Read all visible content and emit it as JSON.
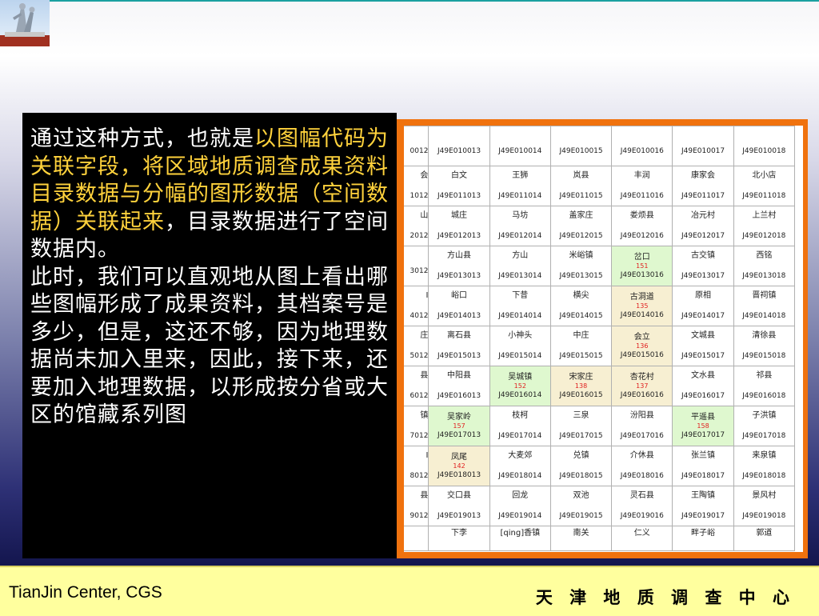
{
  "slide": {
    "paragraph1": {
      "part1": "通过这种方式，也就是",
      "highlight": "以图幅代码为关联字段，将区域地质调查成果资料目录数据与分幅的图形数据（空间数据）关联起来",
      "part2": "，目录数据进行了空间数据内。"
    },
    "paragraph2": "此时，我们可以直观地从图上看出哪些图幅形成了成果资料，其档案号是多少，但是，这还不够，因为地理数据尚未加入里来，因此，接下来，还要加入地理数据，以形成按分省或大区的馆藏系列图",
    "highlight_color": "#ffd23c"
  },
  "footer": {
    "left": "TianJin Center, CGS",
    "right": "天 津 地 质 调 查 中 心"
  },
  "colors": {
    "frame_orange": "#f0720e",
    "footer_yellow": "#ffff9e",
    "cell_green": "#dff8cf",
    "cell_beige": "#f7efd2",
    "number_red": "#e02020"
  },
  "map_table": {
    "rows": [
      {
        "cells": [
          {
            "name": "",
            "code": "0012"
          },
          {
            "name": "",
            "code": "J49E010013"
          },
          {
            "name": "",
            "code": "J49E010014"
          },
          {
            "name": "",
            "code": "J49E010015"
          },
          {
            "name": "",
            "code": "J49E010016"
          },
          {
            "name": "",
            "code": "J49E010017"
          },
          {
            "name": "",
            "code": "J49E010018"
          }
        ]
      },
      {
        "cells": [
          {
            "name": "会",
            "code": "1012"
          },
          {
            "name": "白文",
            "code": "J49E011013"
          },
          {
            "name": "王狮",
            "code": "J49E011014"
          },
          {
            "name": "岚县",
            "code": "J49E011015"
          },
          {
            "name": "丰润",
            "code": "J49E011016"
          },
          {
            "name": "康家会",
            "code": "J49E011017"
          },
          {
            "name": "北小店",
            "code": "J49E011018"
          }
        ]
      },
      {
        "cells": [
          {
            "name": "山",
            "code": "2012"
          },
          {
            "name": "城庄",
            "code": "J49E012013"
          },
          {
            "name": "马坊",
            "code": "J49E012014"
          },
          {
            "name": "盖家庄",
            "code": "J49E012015"
          },
          {
            "name": "娄烦县",
            "code": "J49E012016"
          },
          {
            "name": "冶元村",
            "code": "J49E012017"
          },
          {
            "name": "上兰村",
            "code": "J49E012018"
          }
        ]
      },
      {
        "cells": [
          {
            "name": "",
            "code": "3012"
          },
          {
            "name": "方山县",
            "code": "J49E013013"
          },
          {
            "name": "方山",
            "code": "J49E013014"
          },
          {
            "name": "米峪镇",
            "code": "J49E013015"
          },
          {
            "name": "岔口",
            "code": "J49E013016",
            "num": "151",
            "bg": "g"
          },
          {
            "name": "古交镇",
            "code": "J49E013017"
          },
          {
            "name": "西铭",
            "code": "J49E013018"
          }
        ]
      },
      {
        "cells": [
          {
            "name": "Ⅰ",
            "code": "4012"
          },
          {
            "name": "峪口",
            "code": "J49E014013"
          },
          {
            "name": "下昔",
            "code": "J49E014014"
          },
          {
            "name": "横尖",
            "code": "J49E014015"
          },
          {
            "name": "古洞道",
            "code": "J49E014016",
            "num": "135",
            "bg": "b"
          },
          {
            "name": "原相",
            "code": "J49E014017"
          },
          {
            "name": "晋祠镇",
            "code": "J49E014018"
          }
        ]
      },
      {
        "cells": [
          {
            "name": "庄",
            "code": "5012"
          },
          {
            "name": "离石县",
            "code": "J49E015013"
          },
          {
            "name": "小神头",
            "code": "J49E015014"
          },
          {
            "name": "中庄",
            "code": "J49E015015"
          },
          {
            "name": "会立",
            "code": "J49E015016",
            "num": "136",
            "bg": "b"
          },
          {
            "name": "文城县",
            "code": "J49E015017"
          },
          {
            "name": "清徐县",
            "code": "J49E015018"
          }
        ]
      },
      {
        "cells": [
          {
            "name": "县",
            "code": "6012"
          },
          {
            "name": "中阳县",
            "code": "J49E016013"
          },
          {
            "name": "吴城镇",
            "code": "J49E016014",
            "num": "152",
            "bg": "g"
          },
          {
            "name": "宋家庄",
            "code": "J49E016015",
            "num": "138",
            "bg": "b"
          },
          {
            "name": "杏花村",
            "code": "J49E016016",
            "num": "137",
            "bg": "b"
          },
          {
            "name": "文水县",
            "code": "J49E016017"
          },
          {
            "name": "祁县",
            "code": "J49E016018"
          }
        ]
      },
      {
        "cells": [
          {
            "name": "镇",
            "code": "7012"
          },
          {
            "name": "吴家岭",
            "code": "J49E017013",
            "num": "157",
            "bg": "g"
          },
          {
            "name": "枝柯",
            "code": "J49E017014"
          },
          {
            "name": "三泉",
            "code": "J49E017015"
          },
          {
            "name": "汾阳县",
            "code": "J49E017016"
          },
          {
            "name": "平遥县",
            "code": "J49E017017",
            "num": "158",
            "bg": "g"
          },
          {
            "name": "子洪镇",
            "code": "J49E017018"
          }
        ]
      },
      {
        "cells": [
          {
            "name": "Ⅰ",
            "code": "8012"
          },
          {
            "name": "凤尾",
            "code": "J49E018013",
            "num": "142",
            "bg": "b"
          },
          {
            "name": "大麦郊",
            "code": "J49E018014"
          },
          {
            "name": "兑镇",
            "code": "J49E018015"
          },
          {
            "name": "介休县",
            "code": "J49E018016"
          },
          {
            "name": "张兰镇",
            "code": "J49E018017"
          },
          {
            "name": "来泉镇",
            "code": "J49E018018"
          }
        ]
      },
      {
        "cells": [
          {
            "name": "县",
            "code": "9012"
          },
          {
            "name": "交口县",
            "code": "J49E019013"
          },
          {
            "name": "回龙",
            "code": "J49E019014"
          },
          {
            "name": "双池",
            "code": "J49E019015"
          },
          {
            "name": "灵石县",
            "code": "J49E019016"
          },
          {
            "name": "王陶镇",
            "code": "J49E019017"
          },
          {
            "name": "景风村",
            "code": "J49E019018"
          }
        ]
      },
      {
        "last": true,
        "cells": [
          {
            "name": "",
            "code": ""
          },
          {
            "name": "下李",
            "code": ""
          },
          {
            "name": "[qing]香镇",
            "code": ""
          },
          {
            "name": "南关",
            "code": ""
          },
          {
            "name": "仁义",
            "code": ""
          },
          {
            "name": "畔子峪",
            "code": ""
          },
          {
            "name": "郭道",
            "code": ""
          }
        ]
      }
    ]
  }
}
